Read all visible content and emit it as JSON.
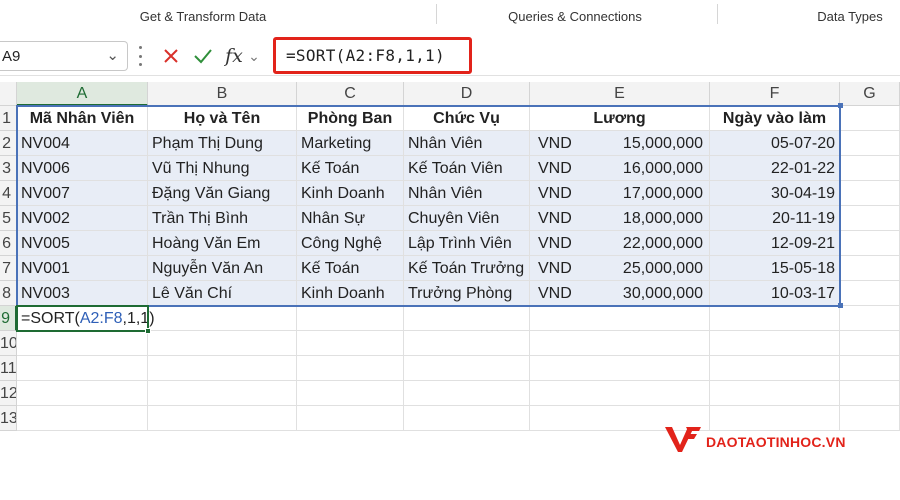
{
  "ribbon": {
    "groups": [
      "Get & Transform Data",
      "Queries & Connections",
      "Data Types"
    ]
  },
  "formula_bar": {
    "name_box": "A9",
    "formula": "=SORT(A2:F8,1,1)",
    "highlight_color": "#e2231a"
  },
  "sheet": {
    "columns": [
      "A",
      "B",
      "C",
      "D",
      "E",
      "F",
      "G"
    ],
    "row_numbers": [
      "1",
      "2",
      "3",
      "4",
      "5",
      "6",
      "7",
      "8",
      "9",
      "10",
      "11",
      "12",
      "13"
    ],
    "headers": [
      "Mã Nhân Viên",
      "Họ và Tên",
      "Phòng Ban",
      "Chức Vụ",
      "Lương",
      "Ngày vào làm"
    ],
    "rows": [
      {
        "id": "NV004",
        "name": "Phạm Thị Dung",
        "dept": "Marketing",
        "role": "Nhân Viên",
        "cur": "VND",
        "salary": "15,000,000",
        "date": "05-07-20"
      },
      {
        "id": "NV006",
        "name": "Vũ Thị Nhung",
        "dept": "Kế Toán",
        "role": "Kế Toán Viên",
        "cur": "VND",
        "salary": "16,000,000",
        "date": "22-01-22"
      },
      {
        "id": "NV007",
        "name": "Đặng Văn Giang",
        "dept": "Kinh Doanh",
        "role": "Nhân Viên",
        "cur": "VND",
        "salary": "17,000,000",
        "date": "30-04-19"
      },
      {
        "id": "NV002",
        "name": "Trần Thị Bình",
        "dept": "Nhân Sự",
        "role": "Chuyên Viên",
        "cur": "VND",
        "salary": "18,000,000",
        "date": "20-11-19"
      },
      {
        "id": "NV005",
        "name": "Hoàng Văn Em",
        "dept": "Công Nghệ",
        "role": "Lập Trình Viên",
        "cur": "VND",
        "salary": "22,000,000",
        "date": "12-09-21"
      },
      {
        "id": "NV001",
        "name": "Nguyễn Văn An",
        "dept": "Kế Toán",
        "role": "Kế Toán Trưởng",
        "cur": "VND",
        "salary": "25,000,000",
        "date": "15-05-18"
      },
      {
        "id": "NV003",
        "name": "Lê Văn Chí",
        "dept": "Kinh Doanh",
        "role": "Trưởng Phòng",
        "cur": "VND",
        "salary": "30,000,000",
        "date": "10-03-17"
      }
    ],
    "active_cell_formula": {
      "prefix": "=SORT(",
      "ref": "A2:F8",
      "suffix": ",1,1)"
    },
    "band_color": "#e8edf6",
    "spill_border_color": "#4a72b8",
    "selection_color": "#1e6b33"
  },
  "watermark": {
    "text": "DAOTAOTINHOC.VN",
    "color": "#e2231a"
  }
}
